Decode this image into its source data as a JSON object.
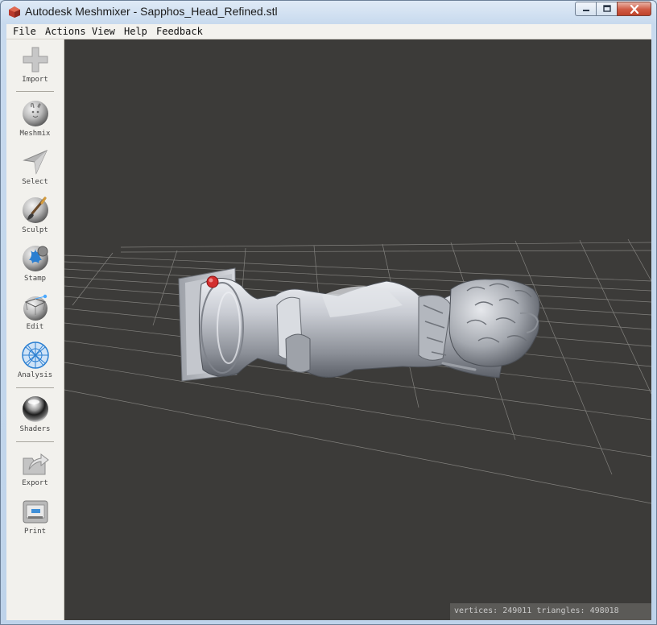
{
  "window": {
    "title": "Autodesk Meshmixer - Sapphos_Head_Refined.stl"
  },
  "menu": [
    {
      "label": "File"
    },
    {
      "label": "Actions"
    },
    {
      "label": "View"
    },
    {
      "label": "Help"
    },
    {
      "label": "Feedback"
    }
  ],
  "toolbar": {
    "tools": [
      {
        "label": "Import",
        "icon": "plus-icon"
      },
      {
        "label": "Meshmix",
        "icon": "bunny-ball-icon"
      },
      {
        "label": "Select",
        "icon": "arrow-cursor-icon"
      },
      {
        "label": "Sculpt",
        "icon": "brush-ball-icon"
      },
      {
        "label": "Stamp",
        "icon": "stamp-ball-icon"
      },
      {
        "label": "Edit",
        "icon": "edit-ball-icon"
      },
      {
        "label": "Analysis",
        "icon": "mesh-ball-icon"
      },
      {
        "label": "Shaders",
        "icon": "chrome-ball-icon"
      },
      {
        "label": "Export",
        "icon": "export-arrow-icon"
      },
      {
        "label": "Print",
        "icon": "printer-icon"
      }
    ]
  },
  "status": {
    "text": "vertices: 249011 triangles: 498018"
  },
  "colors": {
    "viewport_bg": "#3c3b39",
    "grid_line": "#8e8d89",
    "model": "#c9ccd2",
    "pivot_marker": "#d32f2f"
  }
}
